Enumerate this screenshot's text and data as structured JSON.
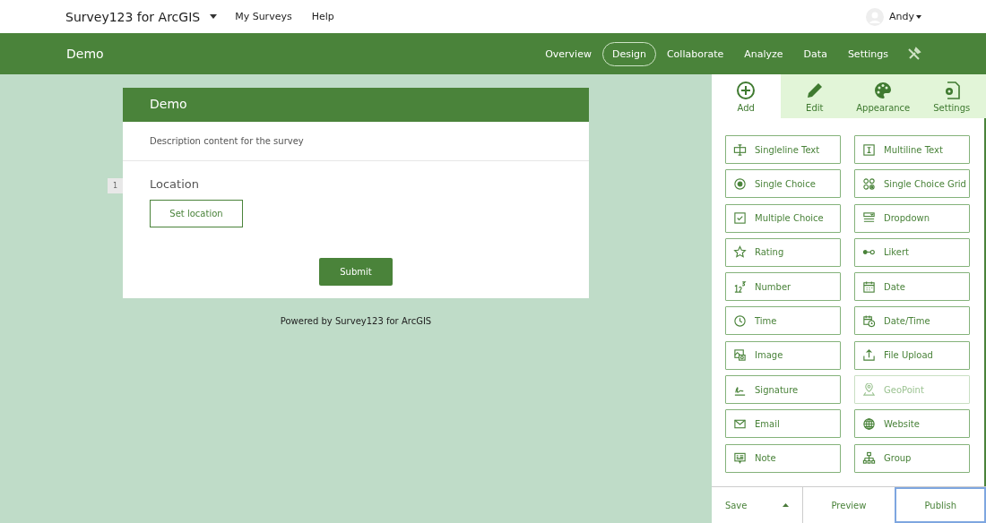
{
  "top_bar": {
    "app_title": "Survey123 for ArcGIS",
    "menu_links": [
      "My Surveys",
      "Help"
    ],
    "user": "Andy"
  },
  "survey_bar": {
    "title": "Demo",
    "tabs": [
      {
        "label": "Overview",
        "selected": false
      },
      {
        "label": "Design",
        "selected": true
      },
      {
        "label": "Collaborate",
        "selected": false
      },
      {
        "label": "Analyze",
        "selected": false
      },
      {
        "label": "Data",
        "selected": false
      },
      {
        "label": "Settings",
        "selected": false
      }
    ]
  },
  "form": {
    "header": "Demo",
    "description": "Description content for the survey",
    "question_number": "1",
    "question_label": "Location",
    "location_button": "Set location",
    "submit_button": "Submit",
    "footer": "Powered by Survey123 for ArcGIS"
  },
  "panel": {
    "tabs": [
      {
        "label": "Add",
        "selected": true
      },
      {
        "label": "Edit",
        "selected": false
      },
      {
        "label": "Appearance",
        "selected": false
      },
      {
        "label": "Settings",
        "selected": false
      }
    ],
    "fields": [
      {
        "label": "Singleline Text",
        "disabled": false
      },
      {
        "label": "Multiline Text",
        "disabled": false
      },
      {
        "label": "Single Choice",
        "disabled": false
      },
      {
        "label": "Single Choice Grid",
        "disabled": false
      },
      {
        "label": "Multiple Choice",
        "disabled": false
      },
      {
        "label": "Dropdown",
        "disabled": false
      },
      {
        "label": "Rating",
        "disabled": false
      },
      {
        "label": "Likert",
        "disabled": false
      },
      {
        "label": "Number",
        "disabled": false
      },
      {
        "label": "Date",
        "disabled": false
      },
      {
        "label": "Time",
        "disabled": false
      },
      {
        "label": "Date/Time",
        "disabled": false
      },
      {
        "label": "Image",
        "disabled": false
      },
      {
        "label": "File Upload",
        "disabled": false
      },
      {
        "label": "Signature",
        "disabled": false
      },
      {
        "label": "GeoPoint",
        "disabled": true
      },
      {
        "label": "Email",
        "disabled": false
      },
      {
        "label": "Website",
        "disabled": false
      },
      {
        "label": "Note",
        "disabled": false
      },
      {
        "label": "Group",
        "disabled": false
      }
    ],
    "actions": [
      {
        "label": "Save",
        "focused": false
      },
      {
        "label": "Preview",
        "focused": false
      },
      {
        "label": "Publish",
        "focused": true
      }
    ]
  }
}
